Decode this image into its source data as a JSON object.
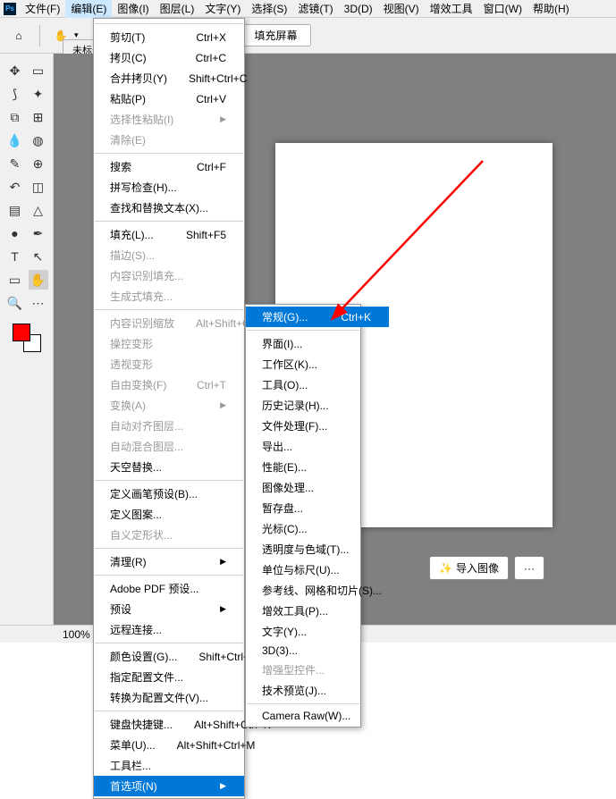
{
  "menubar": {
    "file": "文件(F)",
    "edit": "编辑(E)",
    "image": "图像(I)",
    "layer": "图层(L)",
    "type": "文字(Y)",
    "select": "选择(S)",
    "filter": "滤镜(T)",
    "3d": "3D(D)",
    "view": "视图(V)",
    "plugins": "增效工具",
    "window": "窗口(W)",
    "help": "帮助(H)"
  },
  "optbar": {
    "fill": "填充屏幕"
  },
  "tab": {
    "title": "未标题-"
  },
  "status": {
    "zoom": "100%"
  },
  "float": {
    "import": "导入图像",
    "more": "···"
  },
  "edit_menu": [
    {
      "t": "sep"
    },
    {
      "label": "剪切(T)",
      "shortcut": "Ctrl+X"
    },
    {
      "label": "拷贝(C)",
      "shortcut": "Ctrl+C"
    },
    {
      "label": "合并拷贝(Y)",
      "shortcut": "Shift+Ctrl+C"
    },
    {
      "label": "粘贴(P)",
      "shortcut": "Ctrl+V"
    },
    {
      "label": "选择性粘贴(I)",
      "submenu": true,
      "disabled": true
    },
    {
      "label": "清除(E)",
      "disabled": true
    },
    {
      "t": "sep"
    },
    {
      "label": "搜索",
      "shortcut": "Ctrl+F"
    },
    {
      "label": "拼写检查(H)..."
    },
    {
      "label": "查找和替换文本(X)..."
    },
    {
      "t": "sep"
    },
    {
      "label": "填充(L)...",
      "shortcut": "Shift+F5"
    },
    {
      "label": "描边(S)...",
      "disabled": true
    },
    {
      "label": "内容识别填充...",
      "disabled": true
    },
    {
      "label": "生成式填充...",
      "disabled": true
    },
    {
      "t": "sep"
    },
    {
      "label": "内容识别缩放",
      "shortcut": "Alt+Shift+Ctrl+C",
      "disabled": true
    },
    {
      "label": "操控变形",
      "disabled": true
    },
    {
      "label": "透视变形",
      "disabled": true
    },
    {
      "label": "自由变换(F)",
      "shortcut": "Ctrl+T",
      "disabled": true
    },
    {
      "label": "变换(A)",
      "submenu": true,
      "disabled": true
    },
    {
      "label": "自动对齐图层...",
      "disabled": true
    },
    {
      "label": "自动混合图层...",
      "disabled": true
    },
    {
      "label": "天空替换..."
    },
    {
      "t": "sep"
    },
    {
      "label": "定义画笔预设(B)..."
    },
    {
      "label": "定义图案..."
    },
    {
      "label": "自义定形状...",
      "disabled": true
    },
    {
      "t": "sep"
    },
    {
      "label": "清理(R)",
      "submenu": true
    },
    {
      "t": "sep"
    },
    {
      "label": "Adobe PDF 预设..."
    },
    {
      "label": "预设",
      "submenu": true
    },
    {
      "label": "远程连接..."
    },
    {
      "t": "sep"
    },
    {
      "label": "颜色设置(G)...",
      "shortcut": "Shift+Ctrl+K"
    },
    {
      "label": "指定配置文件..."
    },
    {
      "label": "转换为配置文件(V)..."
    },
    {
      "t": "sep"
    },
    {
      "label": "键盘快捷键...",
      "shortcut": "Alt+Shift+Ctrl+K"
    },
    {
      "label": "菜单(U)...",
      "shortcut": "Alt+Shift+Ctrl+M"
    },
    {
      "label": "工具栏..."
    },
    {
      "label": "首选项(N)",
      "submenu": true,
      "highlight": true
    }
  ],
  "pref_menu": [
    {
      "label": "常规(G)...",
      "shortcut": "Ctrl+K",
      "highlight": true
    },
    {
      "t": "sep"
    },
    {
      "label": "界面(I)..."
    },
    {
      "label": "工作区(K)..."
    },
    {
      "label": "工具(O)..."
    },
    {
      "label": "历史记录(H)..."
    },
    {
      "label": "文件处理(F)..."
    },
    {
      "label": "导出..."
    },
    {
      "label": "性能(E)..."
    },
    {
      "label": "图像处理..."
    },
    {
      "label": "暂存盘..."
    },
    {
      "label": "光标(C)..."
    },
    {
      "label": "透明度与色域(T)..."
    },
    {
      "label": "单位与标尺(U)..."
    },
    {
      "label": "参考线、网格和切片(S)..."
    },
    {
      "label": "增效工具(P)..."
    },
    {
      "label": "文字(Y)..."
    },
    {
      "label": "3D(3)..."
    },
    {
      "label": "增强型控件...",
      "disabled": true
    },
    {
      "label": "技术预览(J)..."
    },
    {
      "t": "sep"
    },
    {
      "label": "Camera Raw(W)..."
    }
  ]
}
